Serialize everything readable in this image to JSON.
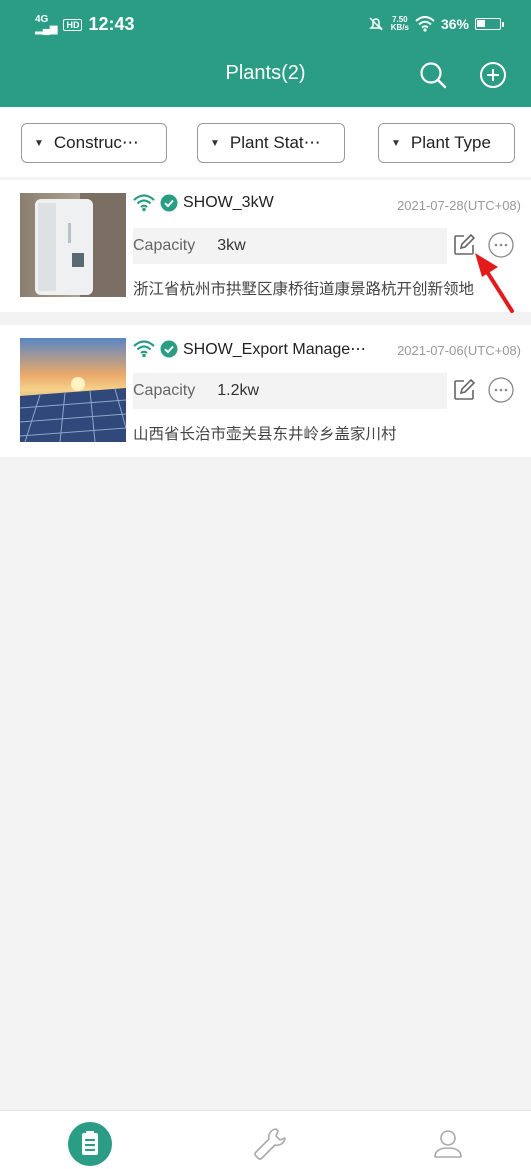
{
  "status_bar": {
    "network": "4G",
    "hd": "HD",
    "time": "12:43",
    "speed_value": "7.50",
    "speed_unit": "KB/s",
    "battery_percent": "36%",
    "battery_level": 0.36
  },
  "header": {
    "title": "Plants(2)",
    "search_icon": "search-icon",
    "add_icon": "add-circle-icon",
    "color": "#2a9d84"
  },
  "filters": [
    {
      "label": "Construc⋯"
    },
    {
      "label": "Plant Stat⋯"
    },
    {
      "label": "Plant Type"
    }
  ],
  "plants": [
    {
      "name": "SHOW_3kW",
      "date": "2021-07-28(UTC+08)",
      "capacity_label": "Capacity",
      "capacity_value": "3kw",
      "address": "浙江省杭州市拱墅区康桥街道康景路杭开创新领地",
      "online": true,
      "verified": true
    },
    {
      "name": "SHOW_Export Manage⋯",
      "date": "2021-07-06(UTC+08)",
      "capacity_label": "Capacity",
      "capacity_value": "1.2kw",
      "address": "山西省长治市壶关县东井岭乡盖家川村",
      "online": true,
      "verified": true
    }
  ],
  "bottom_nav": [
    {
      "icon": "plant-list-icon",
      "active": true
    },
    {
      "icon": "wrench-icon",
      "active": false
    },
    {
      "icon": "user-icon",
      "active": false
    }
  ],
  "colors": {
    "accent": "#2a9d84",
    "annotation_arrow": "#e31b1b"
  }
}
